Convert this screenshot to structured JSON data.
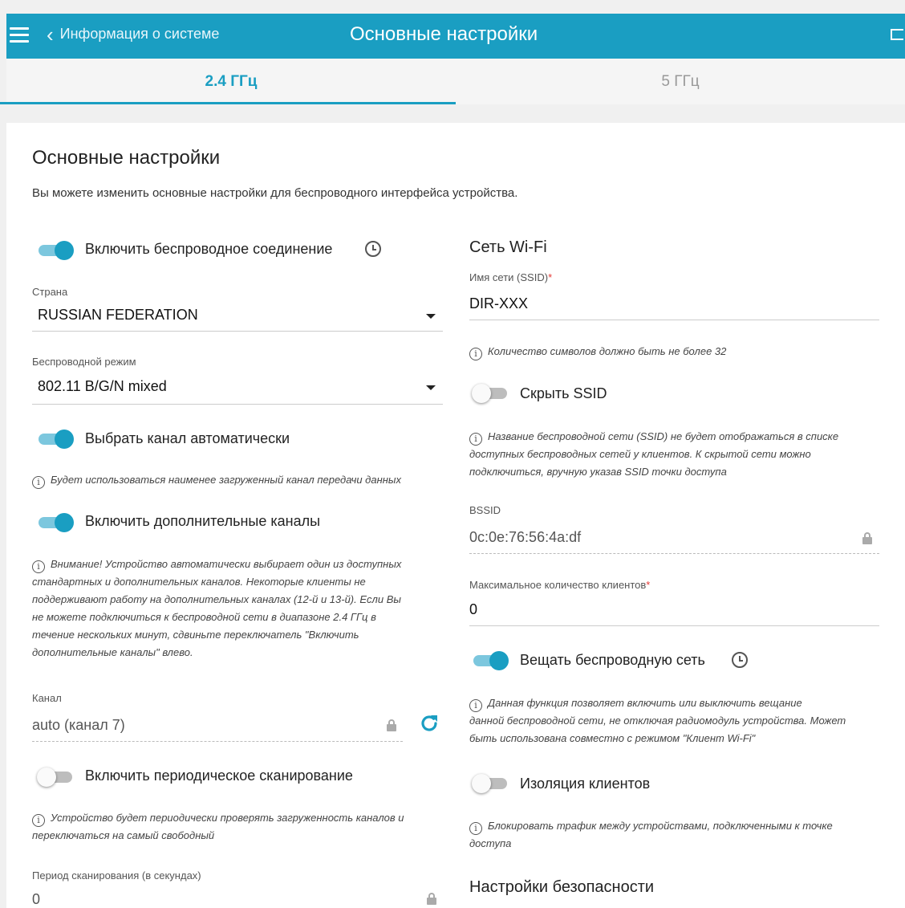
{
  "header": {
    "back_label": "Информация о системе",
    "title": "Основные настройки"
  },
  "tabs": [
    {
      "label": "2.4 ГГц",
      "active": true
    },
    {
      "label": "5 ГГц",
      "active": false
    }
  ],
  "section": {
    "title": "Основные настройки",
    "intro": "Вы можете изменить основные настройки для беспроводного интерфейса устройства."
  },
  "left": {
    "enable_wireless": {
      "label": "Включить беспроводное соединение",
      "on": true
    },
    "country": {
      "label": "Страна",
      "value": "RUSSIAN FEDERATION"
    },
    "mode": {
      "label": "Беспроводной режим",
      "value": "802.11 B/G/N mixed"
    },
    "auto_channel": {
      "label": "Выбрать канал автоматически",
      "on": true,
      "hint": "Будет использоваться наименее загруженный канал передачи данных"
    },
    "extra_channels": {
      "label": "Включить дополнительные каналы",
      "on": true,
      "hint": [
        "Внимание! Устройство автоматически выбирает один из доступных",
        "стандартных и дополнительных каналов. Некоторые клиенты не",
        "поддерживают работу на дополнительных каналах (12-й и 13-й). Если Вы",
        "не можете подключиться к беспроводной сети в диапазоне 2.4 ГГц в",
        "течение нескольких минут, сдвиньте переключатель \"Включить",
        "дополнительные каналы\" влево."
      ]
    },
    "channel": {
      "label": "Канал",
      "value": "auto (канал 7)"
    },
    "periodic_scan": {
      "label": "Включить периодическое сканирование",
      "on": false,
      "hint": [
        "Устройство будет периодически проверять загруженность каналов и",
        "переключаться на самый свободный"
      ]
    },
    "scan_period": {
      "label": "Период сканирования (в секундах)",
      "value": "0"
    }
  },
  "right": {
    "wifi_title": "Сеть Wi-Fi",
    "ssid": {
      "label": "Имя сети (SSID)",
      "required": "*",
      "value": "DIR-XXX",
      "hint": "Количество символов должно быть не более 32"
    },
    "hide_ssid": {
      "label": "Скрыть SSID",
      "on": false,
      "hint": [
        "Название беспроводной сети (SSID) не будет отображаться в списке",
        "доступных беспроводных сетей у клиентов. К скрытой сети можно",
        "подключиться, вручную указав SSID точки доступа"
      ]
    },
    "bssid": {
      "label": "BSSID",
      "value": "0c:0e:76:56:4a:df"
    },
    "max_clients": {
      "label": "Максимальное количество клиентов",
      "required": "*",
      "value": "0"
    },
    "broadcast": {
      "label": "Вещать беспроводную сеть",
      "on": true,
      "hint": [
        "Данная функция позволяет включить или выключить вещание",
        "данной беспроводной сети, не отключая радиомодуль устройства. Может",
        "быть использована совместно с режимом \"Клиент Wi-Fi\""
      ]
    },
    "isolation": {
      "label": "Изоляция клиентов",
      "on": false,
      "hint": [
        "Блокировать трафик между устройствами, подключенными к точке",
        "доступа"
      ]
    },
    "security_title": "Настройки безопасности"
  },
  "colors": {
    "accent": "#1a9ec2",
    "required": "#e53935"
  }
}
